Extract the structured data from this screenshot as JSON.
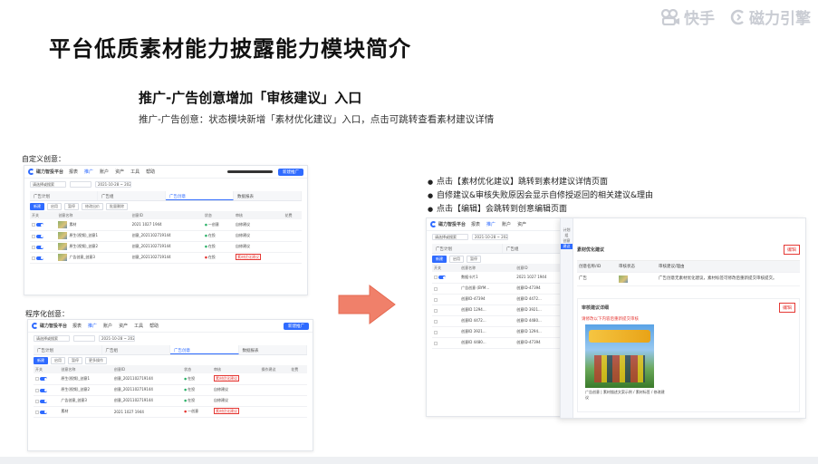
{
  "page": {
    "title": "平台低质素材能力披露能力模块简介",
    "subheading": "推广-广告创意增加「审核建议」入口",
    "description": "推广-广告创意：状态模块新增「素材优化建议」入口，点击可跳转查看素材建议详情"
  },
  "logos": {
    "kuaishou": "快手",
    "cili": "磁力引擎"
  },
  "panels": {
    "custom_label": "自定义创意：",
    "programmatic_label": "程序化创意："
  },
  "bullets": [
    "点击【素材优化建议】跳转到素材建议详情页面",
    "自修建议&审核失败原因会显示自修授返回的相关建议&理由",
    "点击【编辑】会跳转到创意编辑页面"
  ],
  "mini_ui": {
    "app_name": "磁力智投平台",
    "nav": [
      "报表",
      "推广",
      "账户",
      "资产",
      "工具",
      "帮助"
    ],
    "active_nav": "推广",
    "new_button": "新建推广",
    "search_placeholder": "请选择或搜索",
    "date_range": "2021-10-28 ~ 2021-11-04",
    "tabs": [
      "广告计划",
      "广告组",
      "广告创意",
      "数据报表"
    ],
    "tabs_prog": [
      "广告计划",
      "广告组",
      "广告创意",
      "数据报表"
    ],
    "actions": [
      "新建",
      "启用",
      "暂停",
      "修改出价",
      "批量删除",
      "更多操作"
    ],
    "columns": [
      "开关",
      "创意名称",
      "创意ID",
      "状态",
      "审核",
      "操作建议",
      "花费"
    ],
    "rows": [
      {
        "name": "素材",
        "id": "2021 1027 1944",
        "status": "一创意",
        "audit": "自修建议"
      },
      {
        "name": "原生(视频)_创意1",
        "id": "创意_2021102719144",
        "status": "在投",
        "audit": "自修建议"
      },
      {
        "name": "原生(视频)_创意2",
        "id": "创意_2021102719144",
        "status": "在投",
        "audit": "自修建议"
      },
      {
        "name": "广告创意_创意3",
        "id": "创意_2021102719144",
        "status": "在投",
        "audit": "素材优化建议"
      }
    ]
  },
  "right_shot": {
    "title_tab": "广告计划",
    "group_tab": "广告组",
    "id_prefix": "创意ID",
    "rows": [
      "数据卡片1",
      "广告创意 (BYM...",
      "创意ID-47394",
      "创意ID 1294...",
      "创意ID 4472...",
      "创意ID 3921...",
      "创意ID 4480..."
    ]
  },
  "drawer": {
    "side_items": [
      "计划",
      "组",
      "创意",
      "建议"
    ],
    "header": "素材优化建议",
    "edit_label": "编辑",
    "columns": [
      "创意名称/ID",
      "审核状态",
      "审核建议/理由"
    ],
    "row_name": "广告",
    "row_reason": "广告创意无素材优化建议，素材标签可修改后重新提交审核提交。",
    "sugg_title": "审核建议详细",
    "sugg_hint": "请修改以下内容后重新提交审核",
    "edit_label2": "编辑",
    "poster_caption": "广告创意 | 素材描述文案示例 / 素材标签 / 修改建议"
  },
  "colors": {
    "accent": "#2f6bff",
    "highlight_red": "#e53935",
    "arrow": "#f0806a"
  }
}
